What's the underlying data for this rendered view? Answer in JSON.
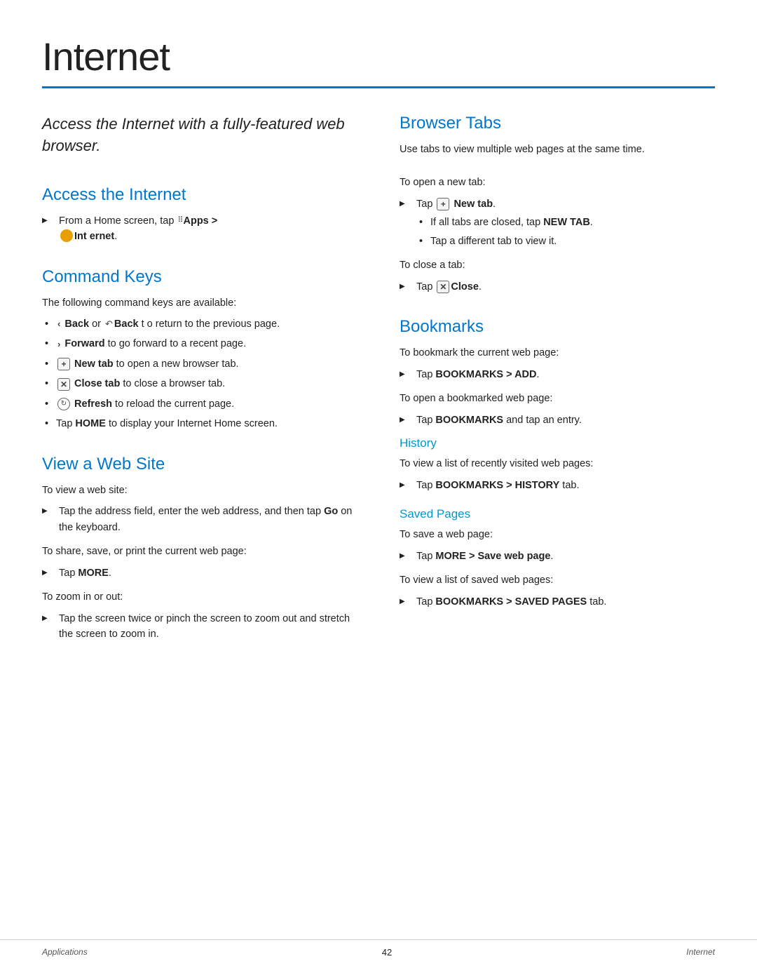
{
  "page": {
    "title": "Internet",
    "footer": {
      "left": "Applications",
      "center": "42",
      "right": "Internet"
    }
  },
  "intro": {
    "text": "Access the Internet with a fully-featured web browser."
  },
  "sections": {
    "access": {
      "heading": "Access the Internet",
      "step": "From a Home screen, tap",
      "apps_label": "Apps >",
      "internet_label": "Int ernet."
    },
    "command_keys": {
      "heading": "Command Keys",
      "intro": "The following command keys are available:",
      "items": [
        "Back or Back t o return to the previous page.",
        "Forward to go forward to a recent page.",
        "New tab to open a new browser tab.",
        "Close tab to close a browser tab.",
        "Refresh to reload the current page.",
        "Tap HOME to display your Internet Home screen."
      ]
    },
    "view_web": {
      "heading": "View a Web Site",
      "para1": "To view a web site:",
      "step1": "Tap the address field, enter the web address, and then tap Go on the keyboard.",
      "para2": "To share, save, or print the current web page:",
      "step2": "Tap MORE.",
      "para3": "To zoom in or out:",
      "step3": "Tap the screen twice or pinch the screen to zoom out and stretch the screen to zoom in."
    },
    "browser_tabs": {
      "heading": "Browser Tabs",
      "intro": "Use tabs to view multiple web pages at the same time.",
      "para1": "To open a new tab:",
      "step1": "Tap",
      "new_tab_label": "New tab.",
      "sub_bullets": [
        "If all tabs are closed, tap NEW TAB.",
        "Tap a different tab to view it."
      ],
      "para2": "To close a tab:",
      "step2": "Tap",
      "close_label": "Close."
    },
    "bookmarks": {
      "heading": "Bookmarks",
      "para1": "To bookmark the current web page:",
      "step1": "Tap BOOKMARKS > ADD.",
      "para2": "To open a bookmarked web page:",
      "step2": "Tap BOOKMARKS and tap an entry.",
      "history": {
        "heading": "History",
        "para1": "To view a list of recently visited web pages:",
        "step1": "Tap BOOKMARKS > HISTORY tab."
      },
      "saved": {
        "heading": "Saved Pages",
        "para1": "To save a web page:",
        "step1": "Tap MORE > Save web page.",
        "para2": "To view a list of saved web pages:",
        "step2": "Tap BOOKMARKS > SAVED PAGES tab."
      }
    }
  }
}
